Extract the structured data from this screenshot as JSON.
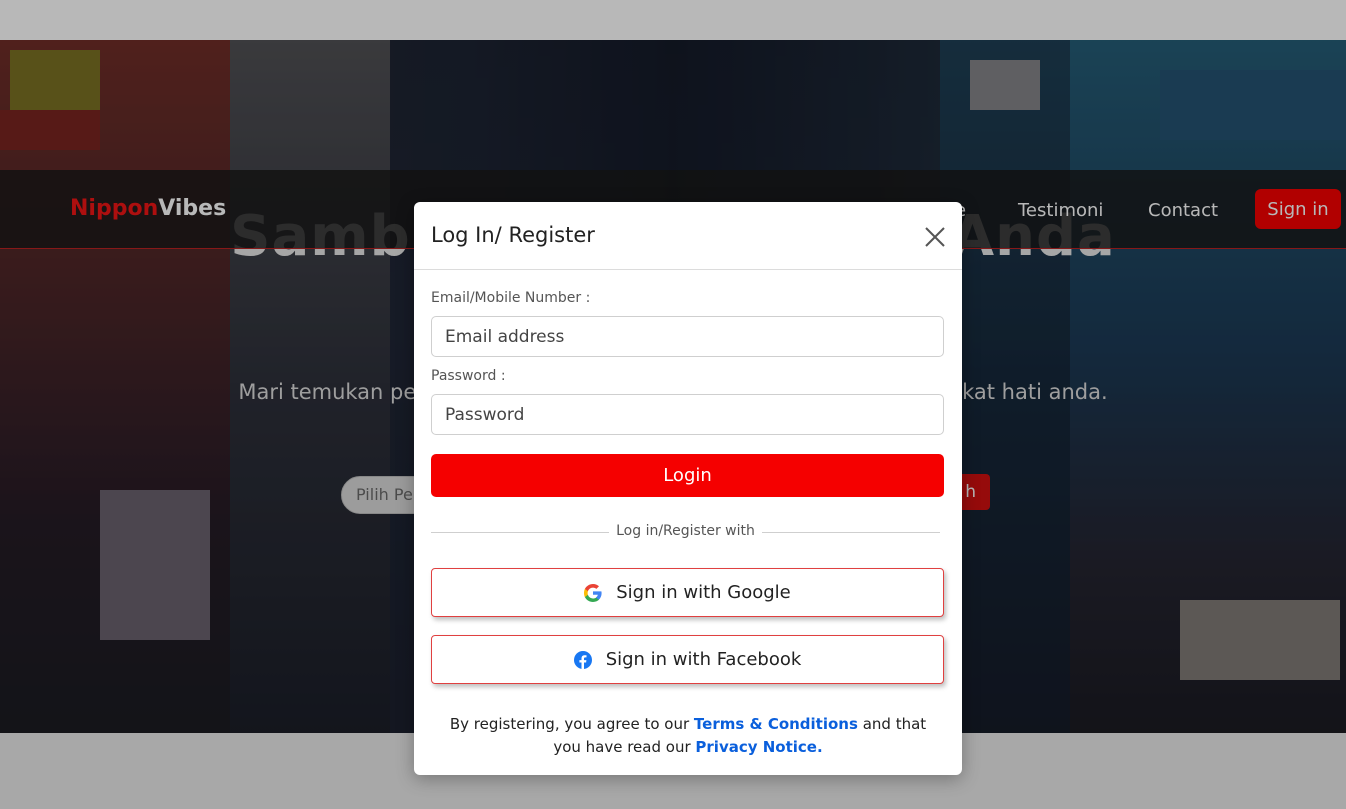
{
  "brand": {
    "part1": "Nippon",
    "part2": "Vibes",
    "part1_color": "#f01515",
    "part2_color": "#ffffff"
  },
  "nav": {
    "home_fragment": "e",
    "testimoni": "Testimoni",
    "contact": "Contact",
    "signin": "Sign in"
  },
  "hero": {
    "title_left": "Samb",
    "title_right": "Anda",
    "subtitle_left": "Mari temukan pe",
    "subtitle_right": "ikat hati anda.",
    "search_placeholder": "Pilih Pe",
    "search_button_fragment": "h"
  },
  "modal": {
    "title": "Log In/ Register",
    "close_icon": "close-icon",
    "email_label": "Email/Mobile Number :",
    "email_placeholder": "Email address",
    "password_label": "Password :",
    "password_placeholder": "Password",
    "login_button": "Login",
    "divider_text": "Log in/Register with",
    "google_button": "Sign in with Google",
    "facebook_button": "Sign in with Facebook",
    "terms_prefix": "By registering, you agree to our",
    "terms_link": "Terms & Conditions",
    "terms_middle": "and that you have read our",
    "privacy_link": "Privacy Notice."
  },
  "colors": {
    "accent": "#f50000",
    "link": "#0a5fdc",
    "facebook": "#1877f2"
  }
}
